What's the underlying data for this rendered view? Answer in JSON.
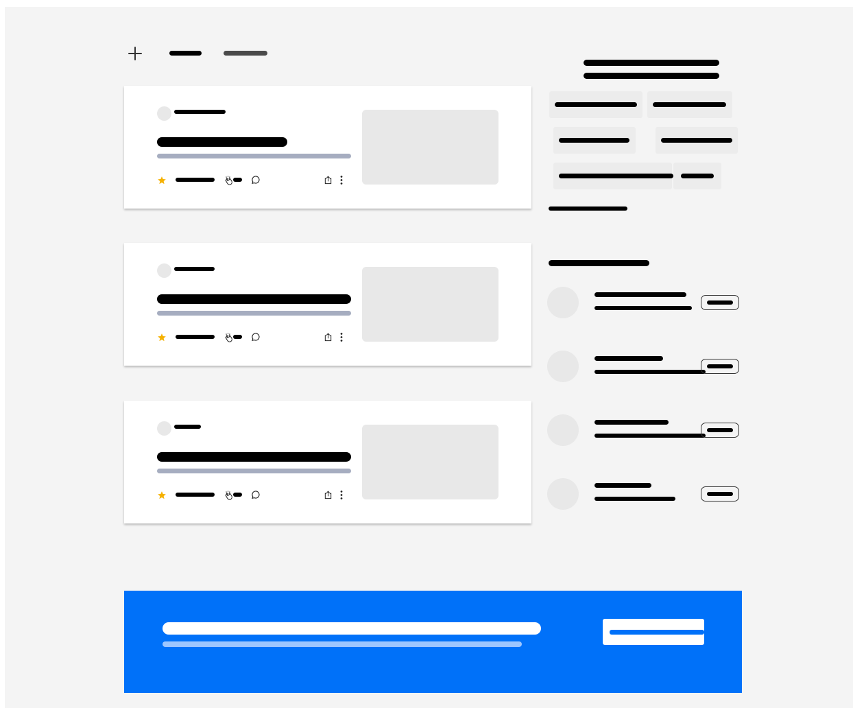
{
  "colors": {
    "background": "#f4f4f4",
    "card": "#ffffff",
    "text_placeholder": "#000000",
    "subtitle_placeholder": "#a6adc0",
    "thumbnail": "#e8e8e8",
    "chip": "#ececec",
    "star": "#f5b100",
    "banner": "#0071f9"
  },
  "toolbar": {
    "add_icon": "plus-icon",
    "tabs": [
      "",
      ""
    ]
  },
  "feed": {
    "articles": [
      {
        "author": "",
        "title": "",
        "subtitle": "",
        "date": "",
        "claps": "",
        "icons": [
          "star-icon",
          "clap-icon",
          "comment-icon",
          "share-icon",
          "more-icon"
        ]
      },
      {
        "author": "",
        "title": "",
        "subtitle": "",
        "date": "",
        "claps": "",
        "icons": [
          "star-icon",
          "clap-icon",
          "comment-icon",
          "share-icon",
          "more-icon"
        ]
      },
      {
        "author": "",
        "title": "",
        "subtitle": "",
        "date": "",
        "claps": "",
        "icons": [
          "star-icon",
          "clap-icon",
          "comment-icon",
          "share-icon",
          "more-icon"
        ]
      }
    ]
  },
  "sidebar": {
    "topics_heading": "",
    "topics": [
      "",
      "",
      "",
      "",
      "",
      ""
    ],
    "see_more": "",
    "follow_heading": "",
    "people": [
      {
        "name": "",
        "bio": "",
        "button": ""
      },
      {
        "name": "",
        "bio": "",
        "button": ""
      },
      {
        "name": "",
        "bio": "",
        "button": ""
      },
      {
        "name": "",
        "bio": "",
        "button": ""
      }
    ]
  },
  "banner": {
    "title": "",
    "subtitle": "",
    "button": ""
  }
}
